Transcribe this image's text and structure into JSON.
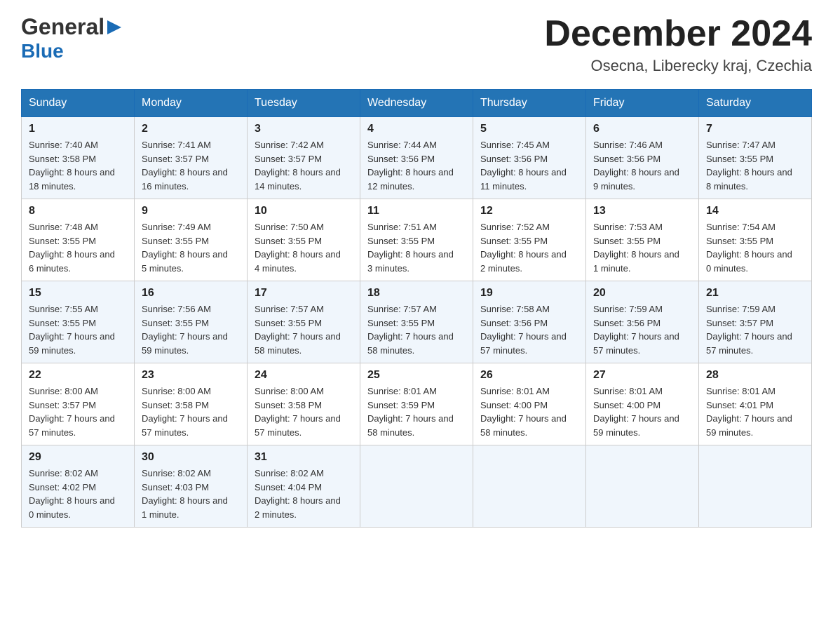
{
  "header": {
    "logo_general": "General",
    "logo_blue": "Blue",
    "title": "December 2024",
    "location": "Osecna, Liberecky kraj, Czechia"
  },
  "weekdays": [
    "Sunday",
    "Monday",
    "Tuesday",
    "Wednesday",
    "Thursday",
    "Friday",
    "Saturday"
  ],
  "weeks": [
    [
      {
        "day": "1",
        "sunrise": "7:40 AM",
        "sunset": "3:58 PM",
        "daylight": "8 hours and 18 minutes."
      },
      {
        "day": "2",
        "sunrise": "7:41 AM",
        "sunset": "3:57 PM",
        "daylight": "8 hours and 16 minutes."
      },
      {
        "day": "3",
        "sunrise": "7:42 AM",
        "sunset": "3:57 PM",
        "daylight": "8 hours and 14 minutes."
      },
      {
        "day": "4",
        "sunrise": "7:44 AM",
        "sunset": "3:56 PM",
        "daylight": "8 hours and 12 minutes."
      },
      {
        "day": "5",
        "sunrise": "7:45 AM",
        "sunset": "3:56 PM",
        "daylight": "8 hours and 11 minutes."
      },
      {
        "day": "6",
        "sunrise": "7:46 AM",
        "sunset": "3:56 PM",
        "daylight": "8 hours and 9 minutes."
      },
      {
        "day": "7",
        "sunrise": "7:47 AM",
        "sunset": "3:55 PM",
        "daylight": "8 hours and 8 minutes."
      }
    ],
    [
      {
        "day": "8",
        "sunrise": "7:48 AM",
        "sunset": "3:55 PM",
        "daylight": "8 hours and 6 minutes."
      },
      {
        "day": "9",
        "sunrise": "7:49 AM",
        "sunset": "3:55 PM",
        "daylight": "8 hours and 5 minutes."
      },
      {
        "day": "10",
        "sunrise": "7:50 AM",
        "sunset": "3:55 PM",
        "daylight": "8 hours and 4 minutes."
      },
      {
        "day": "11",
        "sunrise": "7:51 AM",
        "sunset": "3:55 PM",
        "daylight": "8 hours and 3 minutes."
      },
      {
        "day": "12",
        "sunrise": "7:52 AM",
        "sunset": "3:55 PM",
        "daylight": "8 hours and 2 minutes."
      },
      {
        "day": "13",
        "sunrise": "7:53 AM",
        "sunset": "3:55 PM",
        "daylight": "8 hours and 1 minute."
      },
      {
        "day": "14",
        "sunrise": "7:54 AM",
        "sunset": "3:55 PM",
        "daylight": "8 hours and 0 minutes."
      }
    ],
    [
      {
        "day": "15",
        "sunrise": "7:55 AM",
        "sunset": "3:55 PM",
        "daylight": "7 hours and 59 minutes."
      },
      {
        "day": "16",
        "sunrise": "7:56 AM",
        "sunset": "3:55 PM",
        "daylight": "7 hours and 59 minutes."
      },
      {
        "day": "17",
        "sunrise": "7:57 AM",
        "sunset": "3:55 PM",
        "daylight": "7 hours and 58 minutes."
      },
      {
        "day": "18",
        "sunrise": "7:57 AM",
        "sunset": "3:55 PM",
        "daylight": "7 hours and 58 minutes."
      },
      {
        "day": "19",
        "sunrise": "7:58 AM",
        "sunset": "3:56 PM",
        "daylight": "7 hours and 57 minutes."
      },
      {
        "day": "20",
        "sunrise": "7:59 AM",
        "sunset": "3:56 PM",
        "daylight": "7 hours and 57 minutes."
      },
      {
        "day": "21",
        "sunrise": "7:59 AM",
        "sunset": "3:57 PM",
        "daylight": "7 hours and 57 minutes."
      }
    ],
    [
      {
        "day": "22",
        "sunrise": "8:00 AM",
        "sunset": "3:57 PM",
        "daylight": "7 hours and 57 minutes."
      },
      {
        "day": "23",
        "sunrise": "8:00 AM",
        "sunset": "3:58 PM",
        "daylight": "7 hours and 57 minutes."
      },
      {
        "day": "24",
        "sunrise": "8:00 AM",
        "sunset": "3:58 PM",
        "daylight": "7 hours and 57 minutes."
      },
      {
        "day": "25",
        "sunrise": "8:01 AM",
        "sunset": "3:59 PM",
        "daylight": "7 hours and 58 minutes."
      },
      {
        "day": "26",
        "sunrise": "8:01 AM",
        "sunset": "4:00 PM",
        "daylight": "7 hours and 58 minutes."
      },
      {
        "day": "27",
        "sunrise": "8:01 AM",
        "sunset": "4:00 PM",
        "daylight": "7 hours and 59 minutes."
      },
      {
        "day": "28",
        "sunrise": "8:01 AM",
        "sunset": "4:01 PM",
        "daylight": "7 hours and 59 minutes."
      }
    ],
    [
      {
        "day": "29",
        "sunrise": "8:02 AM",
        "sunset": "4:02 PM",
        "daylight": "8 hours and 0 minutes."
      },
      {
        "day": "30",
        "sunrise": "8:02 AM",
        "sunset": "4:03 PM",
        "daylight": "8 hours and 1 minute."
      },
      {
        "day": "31",
        "sunrise": "8:02 AM",
        "sunset": "4:04 PM",
        "daylight": "8 hours and 2 minutes."
      },
      null,
      null,
      null,
      null
    ]
  ],
  "labels": {
    "sunrise": "Sunrise:",
    "sunset": "Sunset:",
    "daylight": "Daylight:"
  }
}
